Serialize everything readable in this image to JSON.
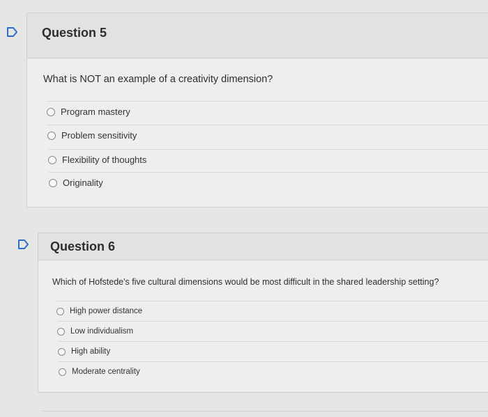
{
  "questions": [
    {
      "title": "Question 5",
      "text": "What is NOT an example of a creativity dimension?",
      "options": [
        "Program mastery",
        "Problem sensitivity",
        "Flexibility of thoughts",
        "Originality"
      ]
    },
    {
      "title": "Question 6",
      "text": "Which of Hofstede's five cultural dimensions would be most difficult in the shared leadership setting?",
      "options": [
        "High power distance",
        "Low individualism",
        "High ability",
        "Moderate centrality"
      ]
    }
  ],
  "colors": {
    "flag_stroke": "#2a6fcf",
    "background": "#e6e6e4",
    "panel": "#eeeeec"
  },
  "icons": {
    "flag": "bookmark-flag-icon",
    "radio": "radio-button-empty"
  }
}
